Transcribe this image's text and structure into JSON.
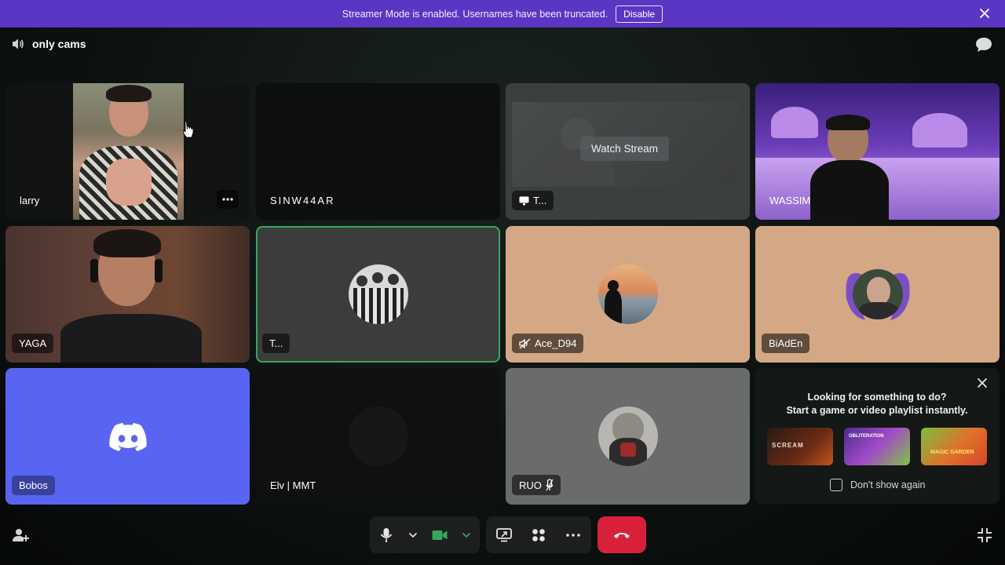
{
  "banner": {
    "text": "Streamer Mode is enabled. Usernames have been truncated.",
    "button": "Disable"
  },
  "channel": {
    "name": "only cams"
  },
  "tiles": [
    {
      "name": "larry"
    },
    {
      "name": "SINW44AR"
    },
    {
      "name": "T...",
      "overlay": "Watch Stream"
    },
    {
      "name": "WASSIM"
    },
    {
      "name": "YAGA"
    },
    {
      "name": "T..."
    },
    {
      "name": "Ace_D94"
    },
    {
      "name": "BiAdEn"
    },
    {
      "name": "Bobos"
    },
    {
      "name": "Elv | MMT"
    },
    {
      "name": "RUO"
    }
  ],
  "activity_panel": {
    "line1": "Looking for something to do?",
    "line2": "Start a game or video playlist instantly.",
    "dont_show": "Don't show again",
    "thumbnails": [
      "SCREAM",
      "OBLITERATION",
      "MAGIC GARDEN"
    ]
  },
  "colors": {
    "banner": "#5b35c4",
    "speaking_border": "#3ba55d",
    "hangup": "#d8203b",
    "discord_blurple": "#5865f2",
    "avatar_bg": "#d4a885"
  }
}
